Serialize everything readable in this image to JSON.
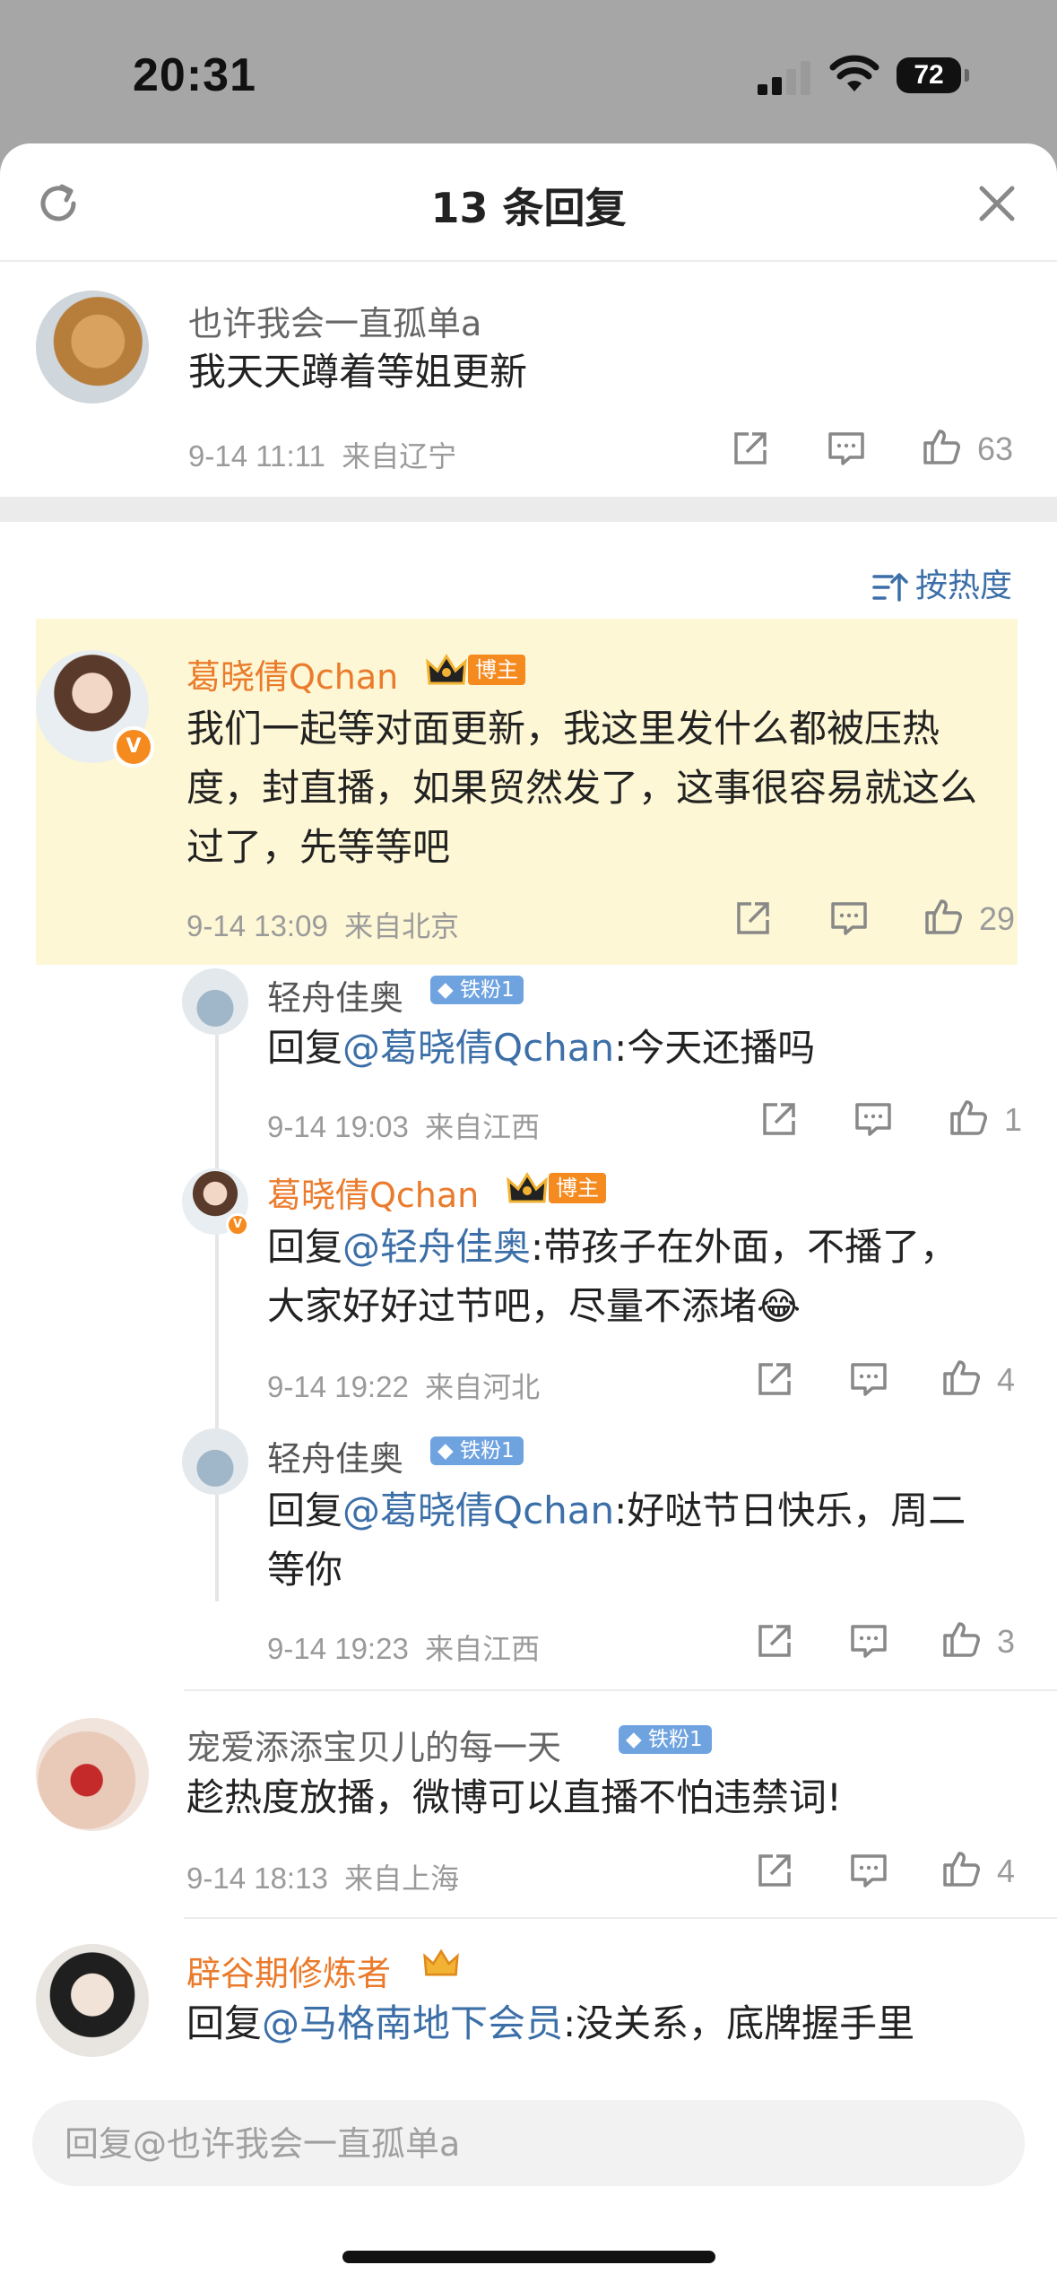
{
  "status_bar": {
    "time": "20:31",
    "battery": "72"
  },
  "header": {
    "title": "13 条回复"
  },
  "sort": {
    "label": "按热度"
  },
  "comments": [
    {
      "name": "也许我会一直孤单a",
      "text": "我天天蹲着等姐更新",
      "date": "9-14 11:11",
      "location": "来自辽宁",
      "likes": "63"
    },
    {
      "name": "葛晓倩Qchan",
      "badge": "博主",
      "text": "我们一起等对面更新，我这里发什么都被压热度，封直播，如果贸然发了，这事很容易就这么过了，先等等吧",
      "date": "9-14 13:09",
      "location": "来自北京",
      "likes": "29",
      "replies": [
        {
          "name": "轻舟佳奥",
          "fan": "铁粉1",
          "prefix": "回复",
          "mention": "@葛晓倩Qchan",
          "text": ":今天还播吗",
          "date": "9-14 19:03",
          "location": "来自江西",
          "likes": "1"
        },
        {
          "name": "葛晓倩Qchan",
          "badge": "博主",
          "prefix": "回复",
          "mention": "@轻舟佳奥",
          "text": ":带孩子在外面，不播了，大家好好过节吧，尽量不添堵",
          "emoji": "😂",
          "date": "9-14 19:22",
          "location": "来自河北",
          "likes": "4"
        },
        {
          "name": "轻舟佳奥",
          "fan": "铁粉1",
          "prefix": "回复",
          "mention": "@葛晓倩Qchan",
          "text": ":好哒节日快乐，周二等你",
          "date": "9-14 19:23",
          "location": "来自江西",
          "likes": "3"
        }
      ]
    },
    {
      "name": "宠爱添添宝贝儿的每一天",
      "fan": "铁粉1",
      "text": "趁热度放播，微博可以直播不怕违禁词!",
      "date": "9-14 18:13",
      "location": "来自上海",
      "likes": "4"
    },
    {
      "name": "辟谷期修炼者",
      "prefix": "回复",
      "mention": "@马格南地下会员",
      "text": ":没关系，底牌握手里"
    }
  ],
  "reply_input": {
    "placeholder": "回复@也许我会一直孤单a"
  },
  "colors": {
    "brand_orange": "#eb7b2c",
    "link_blue": "#3c6fa8",
    "highlight": "#fdf7d5"
  }
}
